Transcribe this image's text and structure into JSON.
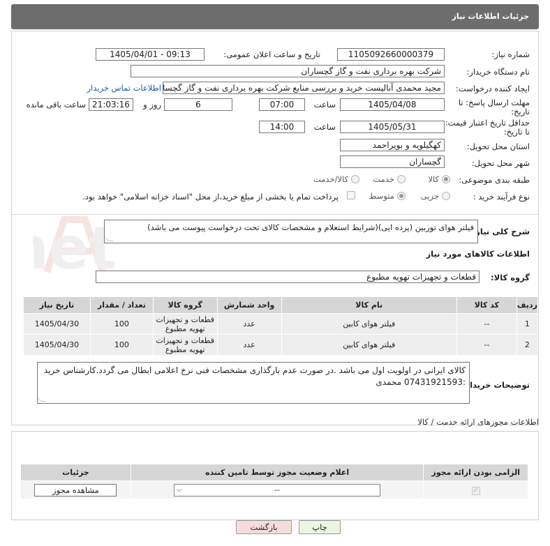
{
  "header": {
    "title": "جزئیات اطلاعات نیاز"
  },
  "fields": {
    "need_number_label": "شماره نیاز:",
    "need_number": "1105092660000379",
    "announce_label": "تاریخ و ساعت اعلان عمومی:",
    "announce_value": "1405/04/01 - 09:13",
    "buyer_org_label": "نام دستگاه خریدار:",
    "buyer_org": "شرکت بهره برداری نفت و گاز گچساران",
    "creator_label": "ایجاد کننده درخواست:",
    "creator": "مجید محمدی آنالیست خرید و بررسی منابع شرکت بهره برداری نفت و گاز گچساران",
    "contact_link": "اطلاعات تماس خریدار",
    "deadline_label_1": "مهلت ارسال پاسخ: تا",
    "deadline_label_2": "تاریخ:",
    "deadline_date": "1405/04/08",
    "time_label": "ساعت",
    "deadline_time": "07:00",
    "days_value": "6",
    "days_label": "روز و",
    "remaining_time": "21:03:16",
    "remaining_label": "ساعت باقی مانده",
    "validity_label_1": "حداقل تاریخ اعتبار قیمت:",
    "validity_label_2": "تا تاریخ:",
    "validity_date": "1405/05/31",
    "validity_time": "14:00",
    "province_label": "استان محل تحویل:",
    "province": "کهگیلویه و بویراحمد",
    "city_label": "شهر محل تحویل:",
    "city": "گچساران",
    "category_label": "طبقه بندی موضوعی:",
    "category_options": [
      "کالا",
      "خدمت",
      "کالا/خدمت"
    ],
    "process_label": "نوع فرآیند خرید :",
    "process_options": [
      "جزیی",
      "متوسط"
    ],
    "payment_note": "پرداخت تمام یا بخشی از مبلغ خرید،از محل \"اسناد خزانه اسلامی\" خواهد بود."
  },
  "description": {
    "label": "شرح کلی نیاز:",
    "text": "فیلتر هوای توربین (پرده ایی)(شرایط استعلام و مشخصات کالای تحت درخواست پیوست می باشد)"
  },
  "goods_section": {
    "title": "اطلاعات کالاهای مورد نیاز",
    "group_label": "گروه کالا:",
    "group_value": "قطعات و تجهیزات تهویه مطبوع"
  },
  "table": {
    "headers": [
      "ردیف",
      "کد کالا",
      "نام کالا",
      "واحد شمارش",
      "گروه کالا",
      "تعداد / مقدار",
      "تاریخ نیاز"
    ],
    "rows": [
      [
        "1",
        "--",
        "فیلتر هوای کابین",
        "عدد",
        "قطعات و تجهیزات تهویه مطبوع",
        "100",
        "1405/04/30"
      ],
      [
        "2",
        "--",
        "فیلتر هوای کابین",
        "عدد",
        "قطعات و تجهیزات تهویه مطبوع",
        "100",
        "1405/04/30"
      ]
    ]
  },
  "buyer_notes": {
    "label": "توضیحات خریدار:",
    "text": "کالای ایرانی در اولویت اول می باشد .در صورت عدم بارگذاری مشخصات فنی نرخ اعلامی ابطال می گردد.کارشناس خرید :07431921593 محمدی"
  },
  "licenses": {
    "title": "اطلاعات مجوزهای ارائه خدمت / کالا",
    "headers": [
      "الزامی بودن ارائه مجوز",
      "اعلام وضعیت مجوز توسط تامین کننده",
      "جزئیات"
    ],
    "select_value": "--",
    "view_button": "مشاهده مجوز"
  },
  "footer": {
    "print_button": "چاپ",
    "back_button": "بازگشت"
  },
  "watermark": "AriaTender.net",
  "colors": {
    "header_bg": "#6d6d6d",
    "link": "#1a57b0",
    "table_header": "#d6d6d6",
    "back_btn": "#f8dcdc",
    "print_btn": "#e9f6e2"
  }
}
